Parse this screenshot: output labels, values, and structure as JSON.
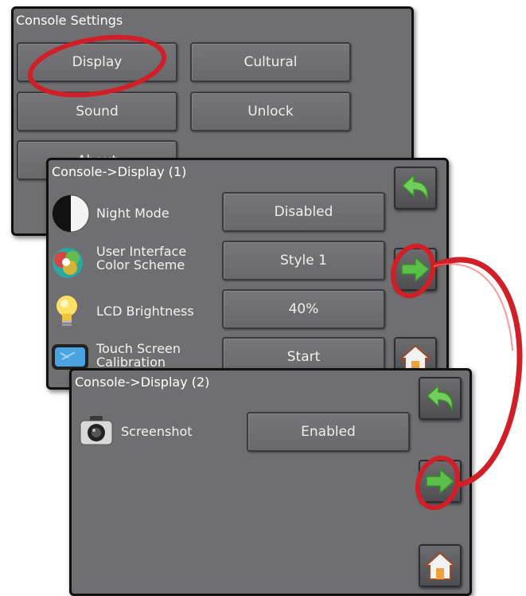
{
  "console_settings": {
    "title": "Console Settings",
    "buttons": {
      "display": "Display",
      "cultural": "Cultural",
      "sound": "Sound",
      "unlock": "Unlock",
      "about": "About"
    }
  },
  "display_page1": {
    "title": "Console->Display (1)",
    "rows": [
      {
        "label_line1": "Night Mode",
        "label_line2": "",
        "value": "Disabled",
        "icon": "night-mode-icon"
      },
      {
        "label_line1": "User Interface",
        "label_line2": "Color Scheme",
        "value": "Style 1",
        "icon": "color-scheme-icon"
      },
      {
        "label_line1": "LCD Brightness",
        "label_line2": "",
        "value": "40%",
        "icon": "lightbulb-icon"
      },
      {
        "label_line1": "Touch Screen",
        "label_line2": "Calibration",
        "value": "Start",
        "icon": "touch-screen-icon"
      }
    ]
  },
  "display_page2": {
    "title": "Console->Display (2)",
    "rows": [
      {
        "label_line1": "Screenshot",
        "value": "Enabled",
        "icon": "camera-icon"
      }
    ]
  },
  "colors": {
    "panel": "#6f6f72",
    "highlight": "#d01f26",
    "nav_green": "#58b947"
  }
}
